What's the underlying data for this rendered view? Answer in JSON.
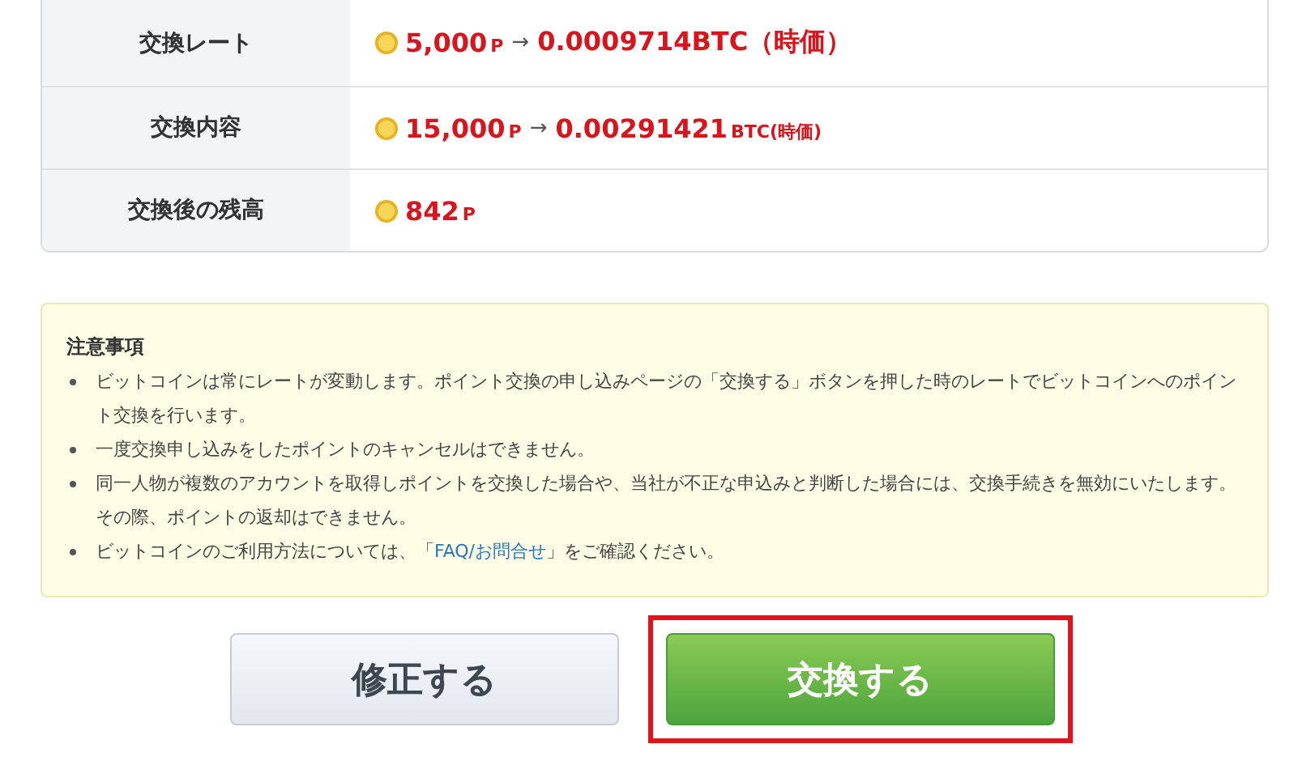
{
  "summary_rows": [
    {
      "label": "交換レート",
      "segments": [
        {
          "kind": "big",
          "text": "5,000"
        },
        {
          "kind": "small",
          "text": "P"
        },
        {
          "kind": "arrow",
          "text": "→"
        },
        {
          "kind": "big",
          "text": "0.0009714BTC（時価）"
        }
      ]
    },
    {
      "label": "交換内容",
      "segments": [
        {
          "kind": "big",
          "text": "15,000"
        },
        {
          "kind": "small",
          "text": "P"
        },
        {
          "kind": "arrow",
          "text": "→"
        },
        {
          "kind": "big",
          "text": "0.00291421"
        },
        {
          "kind": "small",
          "text": "BTC(時価)"
        }
      ]
    },
    {
      "label": "交換後の残高",
      "segments": [
        {
          "kind": "big",
          "text": "842"
        },
        {
          "kind": "small",
          "text": "P"
        }
      ]
    }
  ],
  "notes": {
    "title": "注意事項",
    "items": [
      {
        "text": "ビットコインは常にレートが変動します。ポイント交換の申し込みページの「交換する」ボタンを押した時のレートでビットコインへのポイント交換を行います。"
      },
      {
        "text": "一度交換申し込みをしたポイントのキャンセルはできません。"
      },
      {
        "text": "同一人物が複数のアカウントを取得しポイントを交換した場合や、当社が不正な申込みと判断した場合には、交換手続きを無効にいたします。その際、ポイントの返却はできません。"
      },
      {
        "text": "ビットコインのご利用方法については、「",
        "link": "FAQ/お問合せ",
        "after": "」をご確認ください。"
      }
    ]
  },
  "buttons": [
    {
      "kind": "secondary",
      "label": "修正する",
      "highlighted": false
    },
    {
      "kind": "primary",
      "label": "交換する",
      "highlighted": true
    }
  ]
}
